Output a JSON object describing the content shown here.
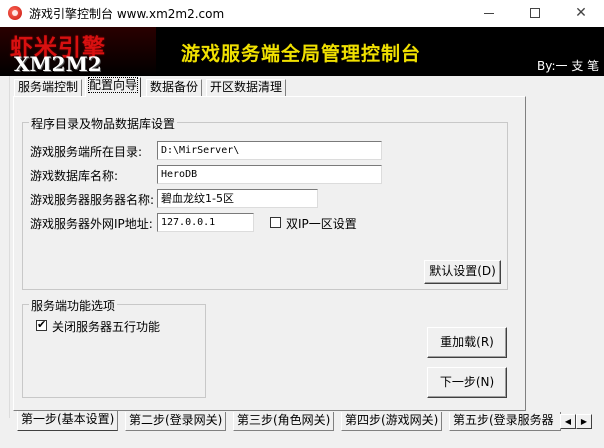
{
  "window": {
    "title": "游戏引擎控制台 www.xm2m2.com",
    "minimize_icon": "minimize-icon",
    "maximize_icon": "maximize-icon",
    "close_glyph": "✕"
  },
  "banner": {
    "logo_cn": "虾米引擎",
    "logo_en": "XM2M2",
    "title": "游戏服务端全局管理控制台",
    "author": "By:一 支 笔",
    "title_color": "#f0e000",
    "logo_color": "#d81010"
  },
  "top_tabs": [
    {
      "label": "服务端控制"
    },
    {
      "label": "配置向导"
    },
    {
      "label": "数据备份"
    },
    {
      "label": "开区数据清理"
    }
  ],
  "group_dir": {
    "legend": "程序目录及物品数据库设置",
    "server_dir_label": "游戏服务端所在目录:",
    "server_dir_value": "D:\\MirServer\\",
    "db_name_label": "游戏数据库名称:",
    "db_name_value": "HeroDB",
    "server_name_label": "游戏服务器服务器名称:",
    "server_name_value": "碧血龙纹1-5区",
    "server_ip_label": "游戏服务器外网IP地址:",
    "server_ip_value": "127.0.0.1",
    "dual_ip_label": "双IP一区设置",
    "dual_ip_checked": false,
    "default_button": "默认设置(D)"
  },
  "group_func": {
    "legend": "服务端功能选项",
    "five_elements_label": "关闭服务器五行功能",
    "five_elements_checked": true,
    "check_glyph": "✔"
  },
  "buttons": {
    "reload": "重加载(R)",
    "next": "下一步(N)"
  },
  "bottom_tabs": [
    {
      "label": "第一步(基本设置)"
    },
    {
      "label": "第二步(登录网关)"
    },
    {
      "label": "第三步(角色网关)"
    },
    {
      "label": "第四步(游戏网关)"
    },
    {
      "label": "第五步(登录服务器"
    }
  ],
  "scroll": {
    "left_glyph": "◀",
    "right_glyph": "▶"
  }
}
